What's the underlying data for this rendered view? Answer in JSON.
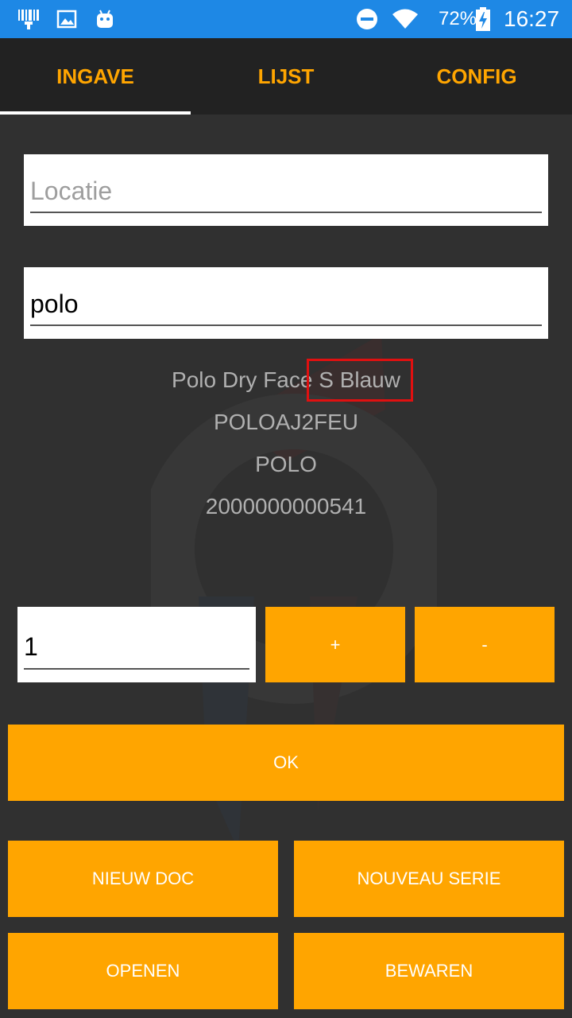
{
  "status_bar": {
    "battery": "72%",
    "time": "16:27",
    "icons": [
      "barcode-scanner-icon",
      "image-icon",
      "android-icon",
      "do-not-disturb-icon",
      "wifi-icon",
      "battery-charging-icon"
    ]
  },
  "tabs": [
    {
      "label": "INGAVE",
      "active": true
    },
    {
      "label": "LIJST",
      "active": false
    },
    {
      "label": "CONFIG",
      "active": false
    }
  ],
  "form": {
    "location": {
      "placeholder": "Locatie",
      "value": ""
    },
    "search": {
      "value": "polo"
    },
    "quantity": {
      "value": "1"
    }
  },
  "product": {
    "name_prefix": "Polo Dry Face",
    "name_highlight": " S Blauw",
    "code": "POLOAJ2FEU",
    "group": "POLO",
    "barcode": "2000000000541"
  },
  "buttons": {
    "plus": "+",
    "minus": "-",
    "ok": "OK",
    "new_doc": "NIEUW DOC",
    "new_series": "NOUVEAU SERIE",
    "open": "OPENEN",
    "save": "BEWAREN"
  },
  "colors": {
    "accent": "#ffa500",
    "status_bar": "#1e88e5",
    "background": "#303030",
    "tab_bar": "#222222",
    "highlight": "#e01010"
  }
}
